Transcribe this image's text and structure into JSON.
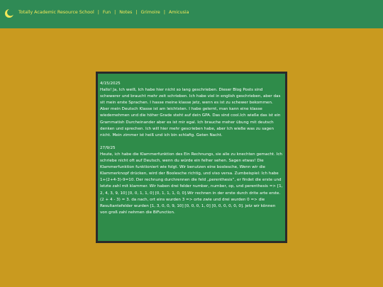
{
  "nav": {
    "items": [
      {
        "label": "Totally Academic Resource  School"
      },
      {
        "label": "Fun"
      },
      {
        "label": "Notes"
      },
      {
        "label": "Grimoire"
      },
      {
        "label": "Amicusia"
      }
    ],
    "separator": "|"
  },
  "entries": [
    {
      "date": "4/15/2025",
      "body": "Hallo! Ja, Ich weiß, Ich habe hier nicht so lang geschrieben. Dieser Blog Posts sind schewerer und braucht mehr zeit schrieben. Ich habe viel in english geschrieben, aber das sit mein erste Sprachen. I hasse meine klasse jetz, wenn es ist zu schewer bekommen. Aber mein Deutsch Klasse ist am leichtsten. I habe gelernt, man kann eine klasse wiedernehmen und die höher Grade steht auf dein GPA. Das sind cool.Ich wieße das ist ein Grammatish Durcheinander aber es ist mir egal. Ich brauche meher übung mit deutsch denken und sprechen. Ich will hier mehr gescrieben habe, aber Ich wieße was zu sagen nicht. Mein zimmer ist heiß und ich bin schlafig. Geten Nacht."
    },
    {
      "date": "27/9/25",
      "body": "Heute, ich habe die Klammerfunktion des Ein Rechnungs, sie alle zu knechten gemacht. Ich schriebe nicht oft auf Deutsch, wenn du würde ein felher sehen. Sagen etwas! Die Klammerfunktion funktioniert wie folgt. Wir benutzen eine boolesche, Wenn wir die Klammerknopf drücken, wird der Boolesche richtig, und viso versa. Zumbeispiel: Ich habe 1+(2+4-3)-9=10. Der rechnung durchrennen die feld „perenthesis“, er findet die erste und letzte zahl mit klammer. Wir haben drei felder number, number, op, und perenthesis => [1, 2, 4, 3, 9, 10] [0, 0, 1, 1, 0] [0, 1, 1, 1, 0, 0].Wir rechnen in der erste durch drite arte erste. (2 + 4 - 3) = 3. da nach, ort eins wurden 3 => orte zwie und drei wurden 0 => die Resultantefelder wurden [1, 3, 0, 0, 9, 10] [0, 0, 0, 1, 0] [0, 0, 0, 0, 0, 0]. jetz wir können von groß zahl nehmen die BiFunction."
    }
  ],
  "colors": {
    "page_bg": "#c99a1f",
    "topbar": "#2f8a55",
    "nav_text": "#f2e85a",
    "card_bg": "#2f8c4a",
    "card_border": "#2a2a2a",
    "card_text": "#ffffff"
  },
  "icons": {
    "logo": "crescent-moon-icon"
  }
}
